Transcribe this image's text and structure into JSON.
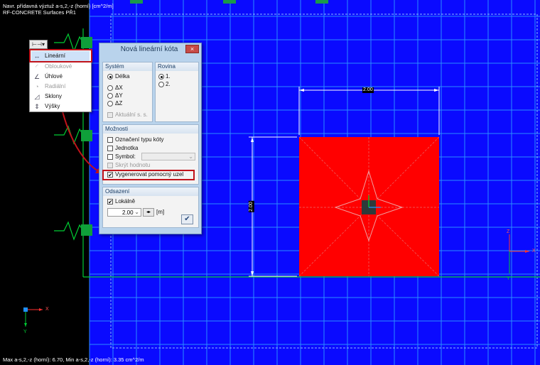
{
  "view": {
    "info_line1": "Navr. přídavná výztuž a-s,2,-z (horní) [cm^2/m]",
    "info_line2": "RF-CONCRETE Surfaces PŘ1",
    "bottom_info": "Max a-s,2,-z (horní): 6.70, Min a-s,2,-z (horní): 3.35 cm^2/m",
    "dim_horizontal": "2.00",
    "dim_vertical": "2.00",
    "axis_x": "X",
    "axis_y": "Y",
    "axis_z": "Z",
    "colors": {
      "background": "#0a0aff",
      "surface": "#ff0000",
      "grid": "#2a8cff",
      "support": "#00cc33",
      "highlight": "#c0121a"
    }
  },
  "menu": {
    "toggle_icon": "dimension-linear-icon",
    "items": [
      {
        "label": "Lineární",
        "icon": "linear-dimension-icon",
        "enabled": true,
        "selected": true
      },
      {
        "label": "Obloukové",
        "icon": "arc-dimension-icon",
        "enabled": false
      },
      {
        "label": "Úhlové",
        "icon": "angular-dimension-icon",
        "enabled": true
      },
      {
        "label": "Radiální",
        "icon": "radial-dimension-icon",
        "enabled": false
      },
      {
        "label": "Sklony",
        "icon": "slope-dimension-icon",
        "enabled": true
      },
      {
        "label": "Výšky",
        "icon": "height-dimension-icon",
        "enabled": true
      }
    ]
  },
  "dialog": {
    "title": "Nová lineární kóta",
    "close": "×",
    "system": {
      "header": "Systém",
      "options": [
        "Délka",
        "ΔX",
        "ΔY",
        "ΔZ"
      ],
      "selected": "Délka",
      "actual_cs": "Aktuální s. s."
    },
    "plane": {
      "header": "Rovina",
      "options": [
        "1.",
        "2."
      ],
      "selected": "1."
    },
    "options": {
      "header": "Možnosti",
      "type_label": "Označení typu kóty",
      "unit": "Jednotka",
      "symbol": "Symbol:",
      "hide_value": "Skrýt hodnotu",
      "generate_node": "Vygenerovat pomocný uzel",
      "generate_node_checked": true
    },
    "offset": {
      "header": "Odsazení",
      "local": "Lokálně",
      "local_checked": true,
      "value": "2.00",
      "unit": "[m]"
    },
    "ok": "✔"
  }
}
